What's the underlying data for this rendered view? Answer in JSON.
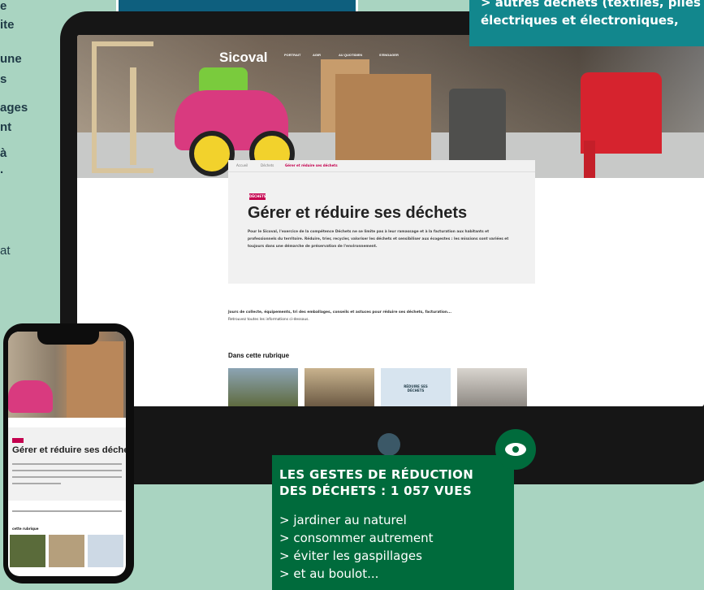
{
  "left_column": {
    "lines": [
      "e",
      "ite",
      "une",
      "s",
      "ages",
      "nt",
      "à",
      "."
    ],
    "tail": "at"
  },
  "teal_box": {
    "line1": "> autres déchets (textiles, piles",
    "line2": "électriques et électroniques,"
  },
  "site": {
    "logo": "Sicoval",
    "nav": [
      "PORTRAIT",
      "AGIR",
      "AU QUOTIDIEN",
      "S'ENGAGER"
    ],
    "breadcrumb": [
      "Accueil",
      "Déchets",
      "Gérer et réduire ses déchets"
    ],
    "tag": "DÉCHETS",
    "title": "Gérer et réduire ses déchets",
    "intro": "Pour le Sicoval, l'exercice de la compétence Déchets ne se limite pas à leur ramassage et à la facturation aux habitants et professionnels du territoire. Réduire, trier, recycler, valoriser les déchets et sensibiliser aux écogestes : les missions sont variées et toujours dans une démarche de préservation de l'environnement.",
    "sub_bold": "Jours de collecte, équipements, tri des emballages, conseils et astuces pour réduire ses déchets, facturation...",
    "sub_rest": "Retrouvez toutes les informations ci-dessous.",
    "rubrique": "Dans cette rubrique",
    "thumb_label": "RÉDUIRE SES DÉCHETS"
  },
  "phone": {
    "title": "Gérer et réduire ses déchets",
    "rubrique": "cette rubrique"
  },
  "green_box": {
    "title_line1": "LES GESTES DE RÉDUCTION",
    "title_line2": "DES DÉCHETS : 1  057 VUES",
    "items": [
      "> jardiner au naturel",
      "> consommer autrement",
      "> éviter les gaspillages",
      "> et au boulot..."
    ]
  },
  "colors": {
    "background": "#a9d4c1",
    "green": "#006b3c",
    "teal": "#12878d",
    "blue": "#0e5f7e",
    "magenta": "#c4004e"
  },
  "icons": [
    "eye-icon"
  ]
}
